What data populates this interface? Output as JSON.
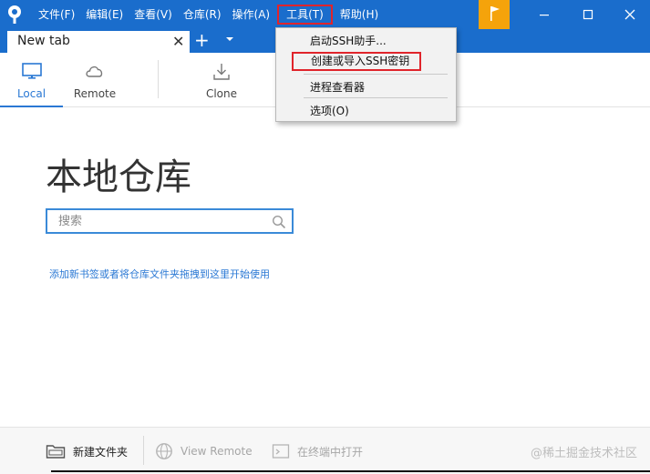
{
  "app": {
    "menu": [
      "文件(F)",
      "编辑(E)",
      "查看(V)",
      "仓库(R)",
      "操作(A)",
      "工具(T)",
      "帮助(H)"
    ],
    "active_menu": "工具(T)"
  },
  "tabs": {
    "current": "New tab",
    "close_glyph": "✕",
    "add_glyph": "+"
  },
  "toolbar": {
    "local": "Local",
    "remote": "Remote",
    "clone": "Clone"
  },
  "tools_menu": {
    "items": [
      "启动SSH助手...",
      "创建或导入SSH密钥",
      "进程查看器",
      "选项(O)"
    ],
    "highlighted": "创建或导入SSH密钥"
  },
  "main": {
    "title": "本地仓库",
    "search_placeholder": "搜索",
    "hint": "添加新书签或者将仓库文件夹拖拽到这里开始使用"
  },
  "bottom": {
    "new_folder": "新建文件夹",
    "view_remote": "View Remote",
    "open_terminal": "在终端中打开"
  },
  "watermark": "@稀土掘金技术社区",
  "colors": {
    "titlebar": "#1a6dcc",
    "flag": "#f5a30b",
    "accent": "#2a78d4",
    "highlight_box": "#e0242b"
  },
  "icons": {
    "logo": "sourcetree-logo-icon",
    "flag": "flag-icon",
    "local": "monitor-icon",
    "remote": "cloud-icon",
    "clone": "download-icon",
    "search": "search-icon",
    "new_folder": "folder-icon",
    "view_remote": "globe-icon",
    "terminal": "terminal-icon"
  }
}
